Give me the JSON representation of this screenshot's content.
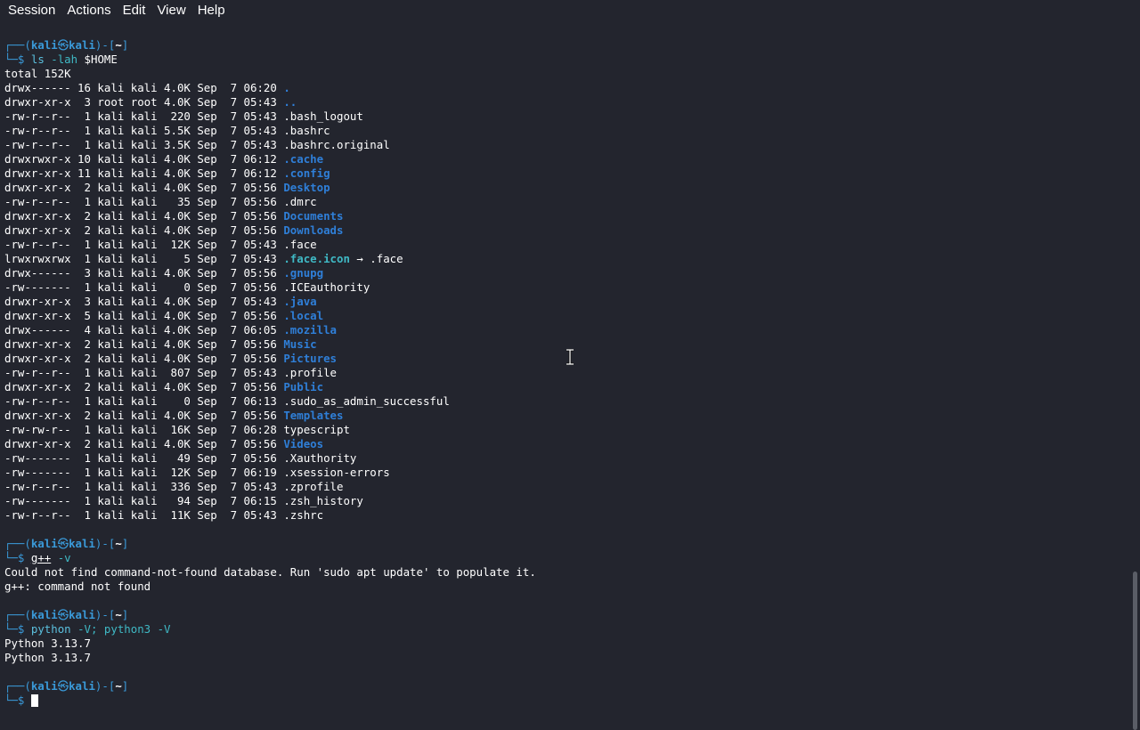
{
  "menubar": {
    "items": [
      "Session",
      "Actions",
      "Edit",
      "View",
      "Help"
    ]
  },
  "prompt": {
    "frame_top": "┌──(",
    "user": "kali",
    "skull": "㉿",
    "host": "kali",
    "frame_mid": ")-[",
    "cwd": "~",
    "frame_end": "]",
    "frame_bottom": "└─",
    "dollar": "$"
  },
  "blocks": [
    {
      "command": "ls",
      "args": " -lah ",
      "var": "$HOME",
      "output_header": "total 152K",
      "listing": [
        {
          "meta": "drwx------ 16 kali kali 4.0K Sep  7 06:20 ",
          "name": ".",
          "type": "dir"
        },
        {
          "meta": "drwxr-xr-x  3 root root 4.0K Sep  7 05:43 ",
          "name": "..",
          "type": "dir"
        },
        {
          "meta": "-rw-r--r--  1 kali kali  220 Sep  7 05:43 ",
          "name": ".bash_logout",
          "type": "file"
        },
        {
          "meta": "-rw-r--r--  1 kali kali 5.5K Sep  7 05:43 ",
          "name": ".bashrc",
          "type": "file"
        },
        {
          "meta": "-rw-r--r--  1 kali kali 3.5K Sep  7 05:43 ",
          "name": ".bashrc.original",
          "type": "file"
        },
        {
          "meta": "drwxrwxr-x 10 kali kali 4.0K Sep  7 06:12 ",
          "name": ".cache",
          "type": "dir"
        },
        {
          "meta": "drwxr-xr-x 11 kali kali 4.0K Sep  7 06:12 ",
          "name": ".config",
          "type": "dir"
        },
        {
          "meta": "drwxr-xr-x  2 kali kali 4.0K Sep  7 05:56 ",
          "name": "Desktop",
          "type": "dir"
        },
        {
          "meta": "-rw-r--r--  1 kali kali   35 Sep  7 05:56 ",
          "name": ".dmrc",
          "type": "file"
        },
        {
          "meta": "drwxr-xr-x  2 kali kali 4.0K Sep  7 05:56 ",
          "name": "Documents",
          "type": "dir"
        },
        {
          "meta": "drwxr-xr-x  2 kali kali 4.0K Sep  7 05:56 ",
          "name": "Downloads",
          "type": "dir"
        },
        {
          "meta": "-rw-r--r--  1 kali kali  12K Sep  7 05:43 ",
          "name": ".face",
          "type": "file"
        },
        {
          "meta": "lrwxrwxrwx  1 kali kali    5 Sep  7 05:43 ",
          "name": ".face.icon",
          "type": "link",
          "target": " → .face"
        },
        {
          "meta": "drwx------  3 kali kali 4.0K Sep  7 05:56 ",
          "name": ".gnupg",
          "type": "dir"
        },
        {
          "meta": "-rw-------  1 kali kali    0 Sep  7 05:56 ",
          "name": ".ICEauthority",
          "type": "file"
        },
        {
          "meta": "drwxr-xr-x  3 kali kali 4.0K Sep  7 05:43 ",
          "name": ".java",
          "type": "dir"
        },
        {
          "meta": "drwxr-xr-x  5 kali kali 4.0K Sep  7 05:56 ",
          "name": ".local",
          "type": "dir"
        },
        {
          "meta": "drwx------  4 kali kali 4.0K Sep  7 06:05 ",
          "name": ".mozilla",
          "type": "dir"
        },
        {
          "meta": "drwxr-xr-x  2 kali kali 4.0K Sep  7 05:56 ",
          "name": "Music",
          "type": "dir"
        },
        {
          "meta": "drwxr-xr-x  2 kali kali 4.0K Sep  7 05:56 ",
          "name": "Pictures",
          "type": "dir"
        },
        {
          "meta": "-rw-r--r--  1 kali kali  807 Sep  7 05:43 ",
          "name": ".profile",
          "type": "file"
        },
        {
          "meta": "drwxr-xr-x  2 kali kali 4.0K Sep  7 05:56 ",
          "name": "Public",
          "type": "dir"
        },
        {
          "meta": "-rw-r--r--  1 kali kali    0 Sep  7 06:13 ",
          "name": ".sudo_as_admin_successful",
          "type": "file"
        },
        {
          "meta": "drwxr-xr-x  2 kali kali 4.0K Sep  7 05:56 ",
          "name": "Templates",
          "type": "dir"
        },
        {
          "meta": "-rw-rw-r--  1 kali kali  16K Sep  7 06:28 ",
          "name": "typescript",
          "type": "file"
        },
        {
          "meta": "drwxr-xr-x  2 kali kali 4.0K Sep  7 05:56 ",
          "name": "Videos",
          "type": "dir"
        },
        {
          "meta": "-rw-------  1 kali kali   49 Sep  7 05:56 ",
          "name": ".Xauthority",
          "type": "file"
        },
        {
          "meta": "-rw-------  1 kali kali  12K Sep  7 06:19 ",
          "name": ".xsession-errors",
          "type": "file"
        },
        {
          "meta": "-rw-r--r--  1 kali kali  336 Sep  7 05:43 ",
          "name": ".zprofile",
          "type": "file"
        },
        {
          "meta": "-rw-------  1 kali kali   94 Sep  7 06:15 ",
          "name": ".zsh_history",
          "type": "file"
        },
        {
          "meta": "-rw-r--r--  1 kali kali  11K Sep  7 05:43 ",
          "name": ".zshrc",
          "type": "file"
        }
      ]
    },
    {
      "command": "g++",
      "args": " -v",
      "command_not_found": true,
      "output": [
        "Could not find command-not-found database. Run 'sudo apt update' to populate it.",
        "g++: command not found"
      ]
    },
    {
      "command": "python",
      "args": " -V; python3 -V",
      "output": [
        "Python 3.13.7",
        "Python 3.13.7"
      ]
    }
  ],
  "colors": {
    "background": "#23252e",
    "prompt_blue": "#3a9ad9",
    "directory_blue": "#2f7fd8",
    "symlink_cyan": "#3fb9c5"
  }
}
